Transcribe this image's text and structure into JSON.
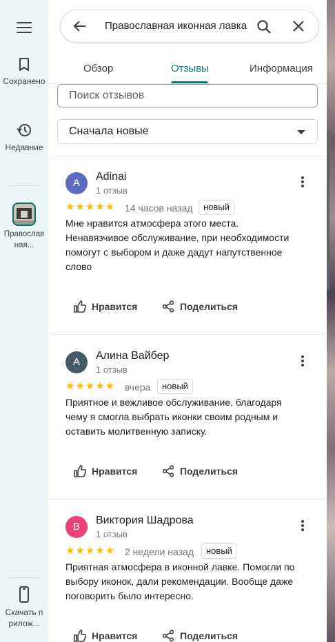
{
  "rail": {
    "saved_label": "Сохранено",
    "recent_label": "Недавние",
    "place_label": "Православная...",
    "download_label": "Скачать прилож..."
  },
  "search": {
    "query": "Православная иконная лавка"
  },
  "tabs": [
    {
      "label": "Обзор",
      "active": false
    },
    {
      "label": "Отзывы",
      "active": true
    },
    {
      "label": "Информация",
      "active": false
    }
  ],
  "reviews_search_placeholder": "Поиск отзывов",
  "sort": {
    "selected": "Сначала новые"
  },
  "actions": {
    "like": "Нравится",
    "share": "Поделиться"
  },
  "reviews": [
    {
      "initial": "A",
      "avatar_color": "#5c6bc0",
      "name": "Adinai",
      "count": "1 отзыв",
      "rating": 5,
      "when": "14 часов назад",
      "badge": "новый",
      "text": "Мне нравится атмосфера этого места. Ненавязчивое обслуживание, при необходимости помогут с выбором и даже дадут напутственное слово"
    },
    {
      "initial": "А",
      "avatar_color": "#455a64",
      "name": "Алина Вайбер",
      "count": "1 отзыв",
      "rating": 5,
      "when": "вчера",
      "badge": "новый",
      "text": "Приятное и вежливое обслуживание, благодаря чему я смогла выбрать иконки своим родным и оставить молитвенную записку."
    },
    {
      "initial": "В",
      "avatar_color": "#ec407a",
      "name": "Виктория Шадрова",
      "count": "1 отзыв",
      "rating": 5,
      "when": "2 недели назад",
      "badge": "новый",
      "text": "Приятная атмосфера в иконной лавке. Помогли по выбору иконок, дали рекомендации. Вообще даже поговорить было интересно."
    }
  ],
  "colors": {
    "accent": "#0b7a6c",
    "star": "#fbbc04",
    "rail_bg": "#eef5f9"
  }
}
